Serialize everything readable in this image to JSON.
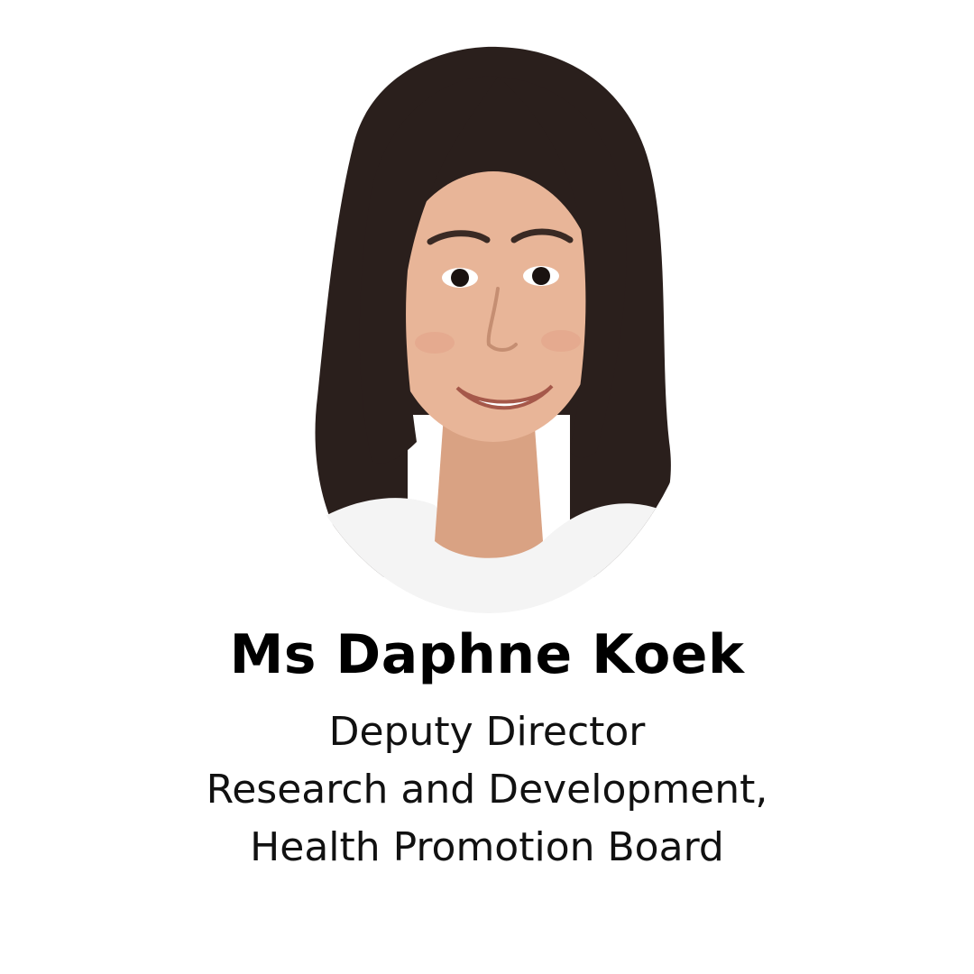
{
  "speaker": {
    "name": "Ms Daphne Koek",
    "lines": [
      "Deputy Director",
      "Research and Development,",
      "Health Promotion Board"
    ]
  },
  "colors": {
    "background": "#ffffff",
    "text": "#000000",
    "hair": "#2a1f1c",
    "skin": "#e8b598",
    "top": "#f4f4f4"
  }
}
